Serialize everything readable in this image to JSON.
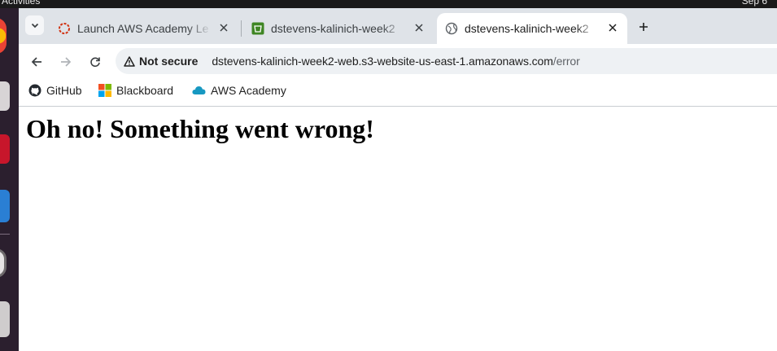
{
  "system": {
    "activities": "Activities",
    "clock": "Sep 6"
  },
  "tabs": [
    {
      "title": "Launch AWS Academy Le",
      "icon": "academy-icon",
      "active": false
    },
    {
      "title": "dstevens-kalinich-week2",
      "icon": "s3-bucket-icon",
      "active": false
    },
    {
      "title": "dstevens-kalinich-week2",
      "icon": "globe-icon",
      "active": true
    }
  ],
  "toolbar": {
    "security_label": "Not secure",
    "url_host": "dstevens-kalinich-week2-web.s3-website-us-east-1.amazonaws.com",
    "url_path": "/error"
  },
  "bookmarks": [
    {
      "label": "GitHub",
      "icon": "github-icon"
    },
    {
      "label": "Blackboard",
      "icon": "blackboard-icon"
    },
    {
      "label": "AWS Academy",
      "icon": "cloud-icon"
    }
  ],
  "page": {
    "heading": "Oh no! Something went wrong!"
  },
  "colors": {
    "tabstrip": "#dfe3e8",
    "omnibox": "#eef1f4",
    "dock": "#2b1f2e",
    "s3_icon": "#3f8624",
    "academy_icon": "#d13212"
  }
}
